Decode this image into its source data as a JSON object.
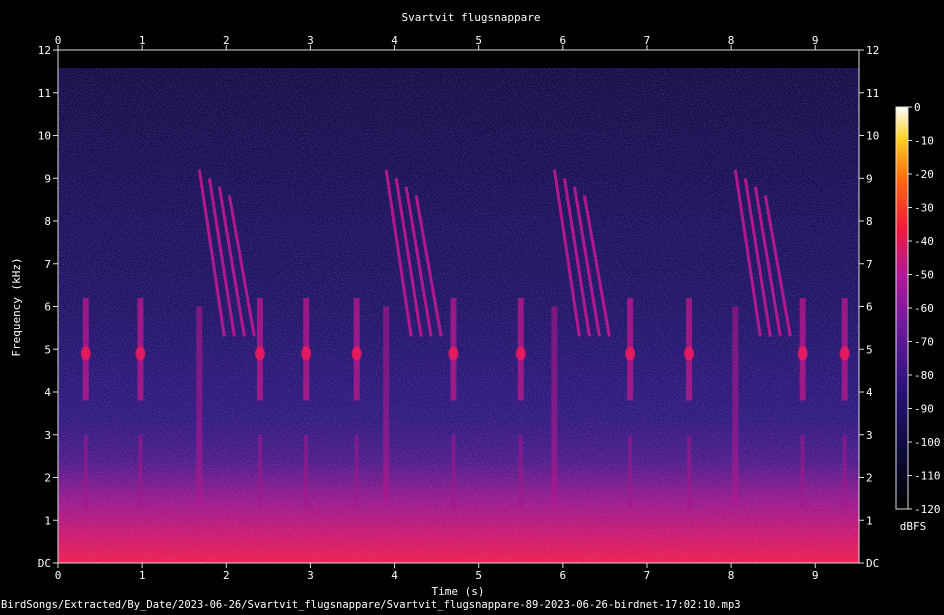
{
  "chart_data": {
    "type": "heatmap",
    "title": "Svartvit flugsnappare",
    "xlabel": "Time (s)",
    "ylabel": "Frequency (kHz)",
    "xlim": [
      0,
      9.52
    ],
    "ylim": [
      0,
      12
    ],
    "x_ticks": [
      "0",
      "1",
      "2",
      "3",
      "4",
      "5",
      "6",
      "7",
      "8",
      "9"
    ],
    "y_ticks": [
      "DC",
      "1",
      "2",
      "3",
      "4",
      "5",
      "6",
      "7",
      "8",
      "9",
      "10",
      "11",
      "12"
    ],
    "colorbar": {
      "label": "dBFS",
      "range": [
        -120,
        0
      ],
      "ticks": [
        "0",
        "-10",
        "-20",
        "-30",
        "-40",
        "-50",
        "-60",
        "-70",
        "-80",
        "-90",
        "-100",
        "-110",
        "-120"
      ]
    },
    "calls": [
      {
        "t": 0.33,
        "type": "note"
      },
      {
        "t": 0.98,
        "type": "note"
      },
      {
        "t": 1.68,
        "type": "sweep"
      },
      {
        "t": 2.4,
        "type": "note"
      },
      {
        "t": 2.95,
        "type": "note"
      },
      {
        "t": 3.55,
        "type": "note"
      },
      {
        "t": 3.9,
        "type": "sweep"
      },
      {
        "t": 4.7,
        "type": "note"
      },
      {
        "t": 5.5,
        "type": "note"
      },
      {
        "t": 5.9,
        "type": "sweep"
      },
      {
        "t": 6.8,
        "type": "note"
      },
      {
        "t": 7.5,
        "type": "note"
      },
      {
        "t": 8.05,
        "type": "sweep"
      },
      {
        "t": 8.85,
        "type": "note"
      },
      {
        "t": 9.35,
        "type": "note"
      }
    ]
  },
  "footer": {
    "file_path": "BirdSongs/Extracted/By_Date/2023-06-26/Svartvit_flugsnappare/Svartvit_flugsnappare-89-2023-06-26-birdnet-17:02:10.mp3"
  }
}
